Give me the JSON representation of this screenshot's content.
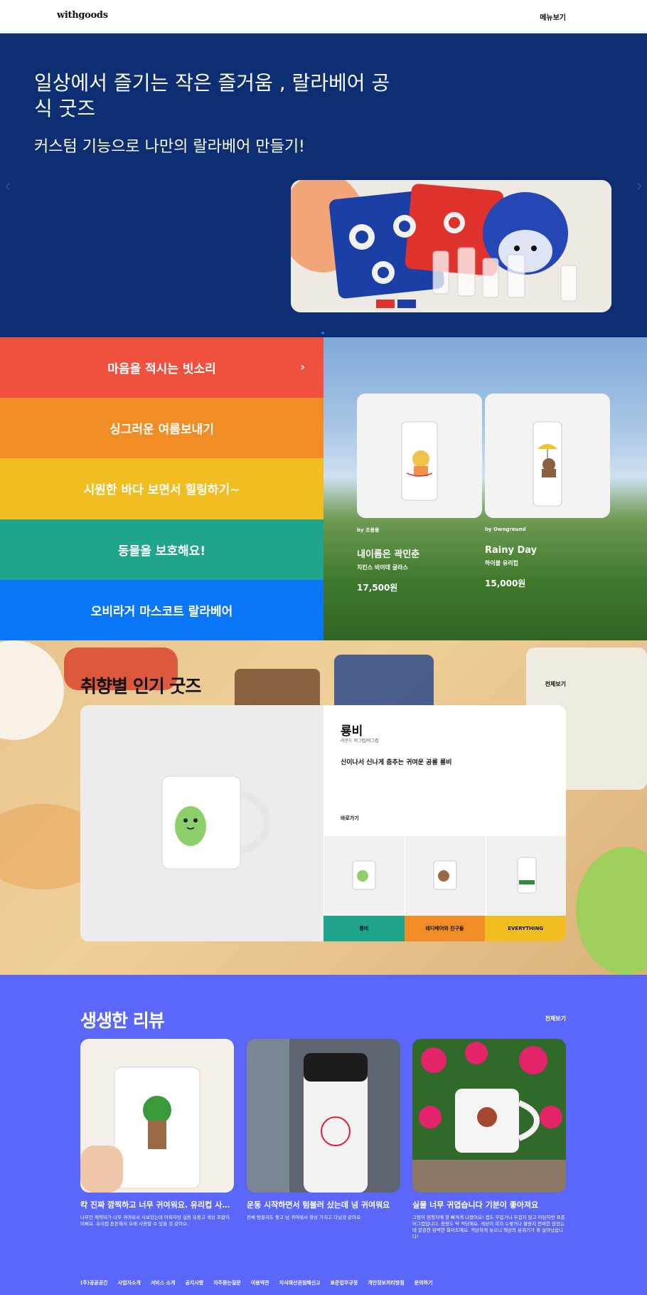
{
  "header": {
    "logo": "withgoods",
    "menu": "메뉴보기"
  },
  "hero": {
    "title": "일상에서 즐기는 작은 즐거움 , 랄라베어 공식 굿즈",
    "subtitle": "커스텀 기능으로 나만의 랄라베어 만들기!",
    "prev_icon": "chevron-left-icon",
    "next_icon": "chevron-right-icon"
  },
  "banners": [
    {
      "label": "마음을 적시는 빗소리",
      "color": "#f0513f"
    },
    {
      "label": "싱그러운 여름보내기",
      "color": "#f28d25"
    },
    {
      "label": "시원한 바다 보면서 힐링하기~",
      "color": "#f2bd21"
    },
    {
      "label": "동물을 보호해요!",
      "color": "#1fa58b"
    },
    {
      "label": "오비라거 마스코트 랄라베어",
      "color": "#0a76f8"
    }
  ],
  "featured": [
    {
      "by": "by 조용용",
      "name": "내이름은 곽민춘",
      "desc": "치킨스 비이데 글라스",
      "price": "17,500원"
    },
    {
      "by": "by Owngreund",
      "name": "Rainy Day",
      "desc": "하이볼 유리컵",
      "price": "15,000원"
    }
  ],
  "popular": {
    "title": "취향별 인기 굿즈",
    "view_all": "전체보기",
    "product": {
      "name": "룡비",
      "category": "라운드 머그컵/머그컵",
      "desc": "신이나서 신나게 춤추는 귀여운 공룡 룡비",
      "go": "바로가기"
    },
    "tabs": [
      {
        "label": "룡비",
        "color": "#1fa58b"
      },
      {
        "label": "테디베어와 친구들",
        "color": "#f28d25"
      },
      {
        "label": "EVERYTHING",
        "color": "#f2bd21"
      }
    ]
  },
  "reviews": {
    "title": "생생한 리뷰",
    "view_all": "전체보기",
    "items": [
      {
        "title": "칵 진짜 깜찍하고 너무 귀여워요. 유리컵 사이즈도",
        "text": "나무인 캐릭터가 너무 귀여워서 사보았는데 아파자망 실용 유용고 색상 조합이 이뻐요. 유리컵 튼튼해서 오래 사용할 수 있을 것 같아요."
      },
      {
        "title": "운동 시작하면서 텀블러 샀는데 넘 귀여워요",
        "text": "전체 텀블러도 좋고 넘 귀여워서 항상 가지고 다닐것 같아요"
      },
      {
        "title": "실물 너무 귀엽습니다 기분이 좋아져요",
        "text": "그림이 엄청지에 잘 빠져게 나왔어요! 컵도 무겁거나 두껍지 않고 아담하면 표준 머그컵입니다. 용량도 딱 적당해요. 색상이 희지 누렇거나 불량지 찐짜한 않았는데 깔끔한 완벽한 화이트예요. 적당하게 놓으니 책상의 분위기가 확 살아났습니다!"
      }
    ]
  },
  "footer": [
    "(주)공공공간",
    "사업자소개",
    "서비스 소개",
    "공지사항",
    "자주묻는질문",
    "이용약관",
    "지식재산권침해신고",
    "표준입무규정",
    "개인정보처리방침",
    "문의하기"
  ]
}
